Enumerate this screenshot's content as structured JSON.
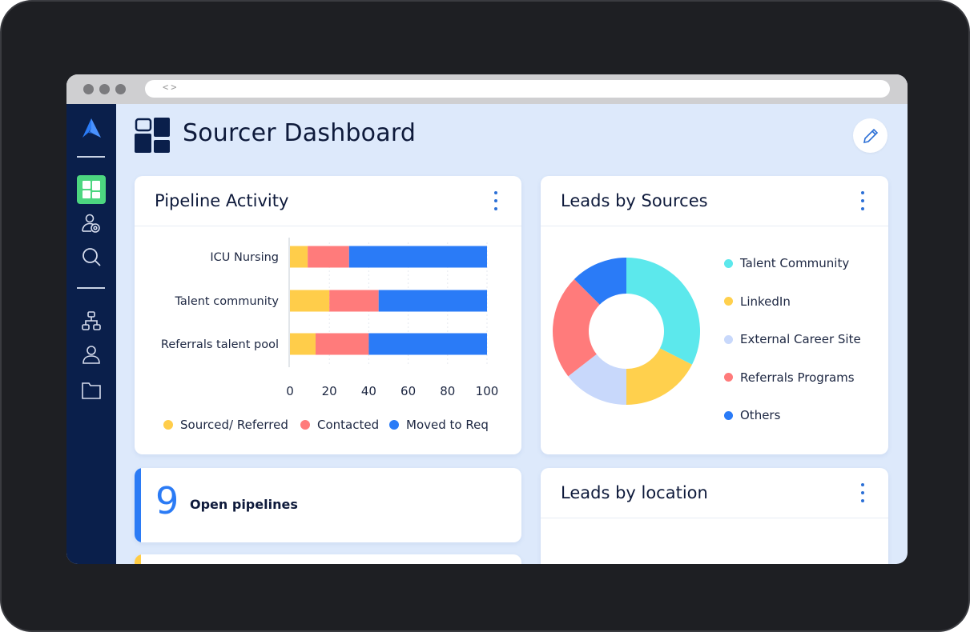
{
  "browser": {
    "nav_glyph": "<>"
  },
  "sidebar": {
    "items": [
      {
        "name": "dashboard",
        "icon": "dashboard-grid-icon",
        "active": true
      },
      {
        "name": "candidates",
        "icon": "user-settings-icon",
        "active": false
      },
      {
        "name": "search",
        "icon": "search-icon",
        "active": false
      },
      {
        "name": "org-chart",
        "icon": "hierarchy-icon",
        "active": false
      },
      {
        "name": "profile",
        "icon": "user-icon",
        "active": false
      },
      {
        "name": "files",
        "icon": "folder-icon",
        "active": false
      }
    ],
    "active_color": "#4cd680",
    "background": "#0a1f4b"
  },
  "header": {
    "title": "Sourcer Dashboard",
    "edit_icon": "pencil-icon"
  },
  "pipeline_card": {
    "title": "Pipeline Activity"
  },
  "sources_card": {
    "title": "Leads by Sources"
  },
  "open_pipelines": {
    "count": "9",
    "label": "Open pipelines",
    "accent": "#2b7bf5"
  },
  "location_card": {
    "title": "Leads by location"
  },
  "chart_data": [
    {
      "type": "bar",
      "orientation": "horizontal",
      "stacked": true,
      "title": "Pipeline Activity",
      "categories": [
        "ICU Nursing",
        "Talent community",
        "Referrals talent pool"
      ],
      "series": [
        {
          "name": "Sourced/ Referred",
          "color": "#ffcd4a",
          "values": [
            9,
            20,
            13
          ]
        },
        {
          "name": "Contacted",
          "color": "#ff7b7b",
          "values": [
            21,
            25,
            27
          ]
        },
        {
          "name": "Moved to Req",
          "color": "#2a7bf7",
          "values": [
            70,
            55,
            60
          ]
        }
      ],
      "xlim": [
        0,
        100
      ],
      "xticks": [
        "0",
        "20",
        "40",
        "60",
        "80",
        "100"
      ],
      "grid": true,
      "legend": "bottom"
    },
    {
      "type": "pie",
      "donut": true,
      "title": "Leads by Sources",
      "categories": [
        "Talent Community",
        "LinkedIn",
        "External Career Site",
        "Referrals Programs",
        "Others"
      ],
      "values": [
        32.5,
        17.5,
        14.5,
        23,
        12.5
      ],
      "colors": [
        "#5ce8ec",
        "#ffd04d",
        "#c8d8fb",
        "#ff7b7b",
        "#2a7bf7"
      ],
      "legend": "right"
    }
  ]
}
